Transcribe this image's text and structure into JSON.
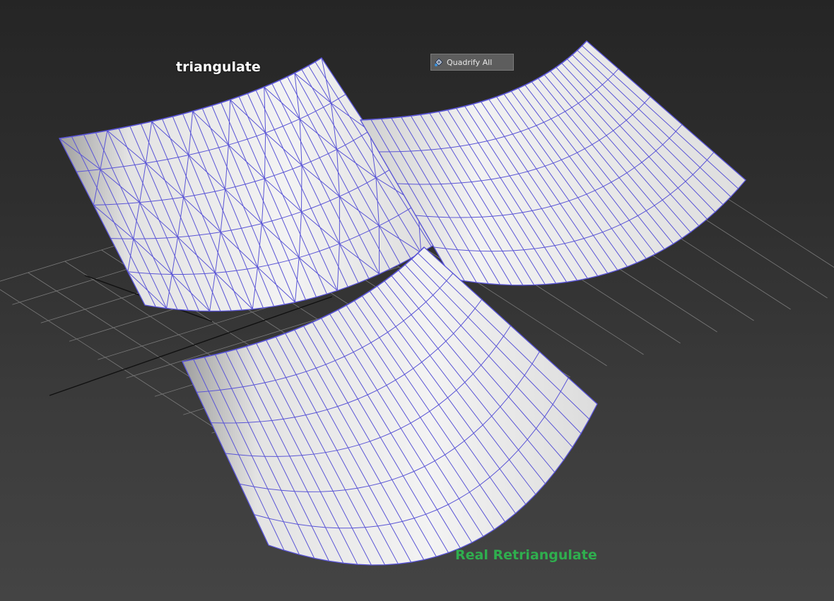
{
  "labels": {
    "triangulate": "triangulate",
    "real_retriangulate": "Real Retriangulate"
  },
  "toolbar": {
    "quadrify_label": "Quadrify All",
    "quadrify_icon": "quadrify-icon"
  },
  "colors": {
    "wire": "#5a55d6",
    "surface": "#f1f1f1",
    "surface_shade": "#b9b9b9",
    "grid": "#7a7a7a",
    "real_label": "#2fae4e"
  }
}
